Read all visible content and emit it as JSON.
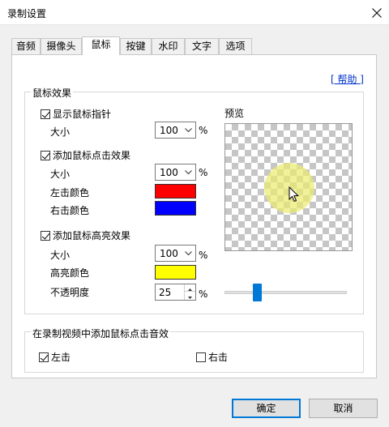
{
  "window": {
    "title": "录制设置"
  },
  "tabs": [
    {
      "label": "音频"
    },
    {
      "label": "摄像头"
    },
    {
      "label": "鼠标"
    },
    {
      "label": "按键"
    },
    {
      "label": "水印"
    },
    {
      "label": "文字"
    },
    {
      "label": "选项"
    }
  ],
  "active_tab": "鼠标",
  "help_link": "[ 帮助 ]",
  "mouse_effects": {
    "group_label": "鼠标效果",
    "show_pointer": {
      "label": "显示鼠标指针",
      "checked": true,
      "size_label": "大小",
      "size_value": "100",
      "unit": "%"
    },
    "click_effect": {
      "label": "添加鼠标点击效果",
      "checked": true,
      "size_label": "大小",
      "size_value": "100",
      "unit": "%",
      "left_color_label": "左击颜色",
      "left_color": "#ff0000",
      "right_color_label": "右击颜色",
      "right_color": "#0000ff"
    },
    "highlight_effect": {
      "label": "添加鼠标高亮效果",
      "checked": true,
      "size_label": "大小",
      "size_value": "100",
      "unit": "%",
      "color_label": "高亮颜色",
      "color": "#ffff00",
      "opacity_label": "不透明度",
      "opacity_value": "25",
      "opacity_unit": "%"
    },
    "preview_label": "预览",
    "preview_slider_fraction": 0.25
  },
  "click_sound": {
    "group_label": "在录制视频中添加鼠标点击音效",
    "left": {
      "label": "左击",
      "checked": true
    },
    "right": {
      "label": "右击",
      "checked": false
    }
  },
  "buttons": {
    "ok": "确定",
    "cancel": "取消"
  },
  "colors": {
    "accent": "#0078d7",
    "link": "#0033cc"
  }
}
